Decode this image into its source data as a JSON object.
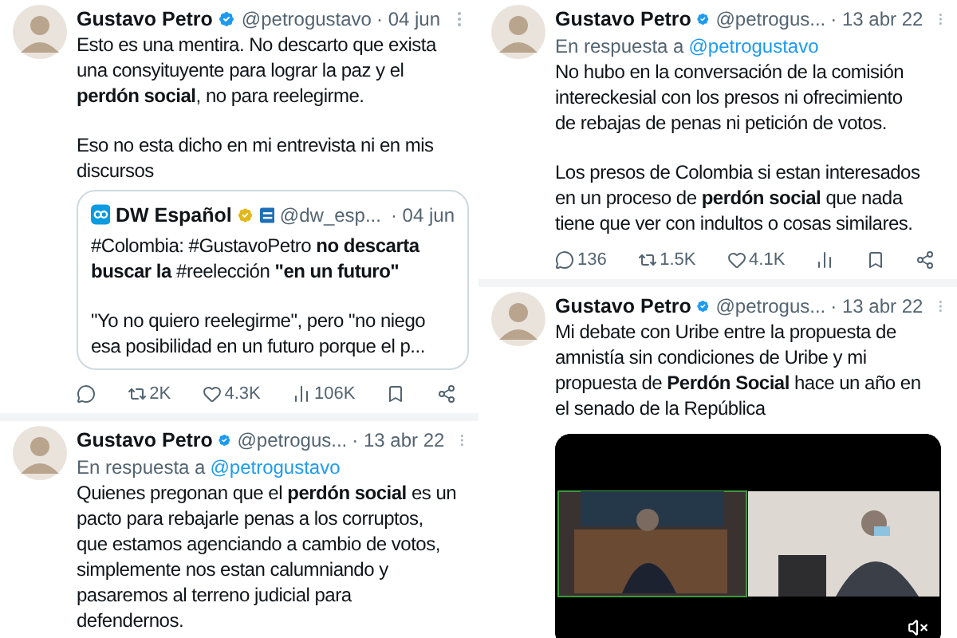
{
  "columns": [
    {
      "tweets": [
        {
          "name": "Gustavo Petro",
          "handle": "@petrogustavo",
          "date": "· 04 jun",
          "paragraphs": [
            "Esto es una mentira. No descarto que exista\nuna consyituyente para lograr la paz y el\n**perdón social**, no para reelegirme.",
            "Eso no esta dicho en mi entrevista ni en mis\ndiscursos"
          ],
          "quote": {
            "name": "DW Español",
            "handle": "@dw_esp...",
            "date": "· 04 jun",
            "paragraphs": [
              "#Colombia: #GustavoPetro **no descarta\nbuscar la** #reelección **\"en un futuro\"**",
              "\"Yo no quiero reelegirme\", pero \"no niego\nesa posibilidad en un futuro porque el p..."
            ]
          },
          "actions": [
            {
              "kind": "reply"
            },
            {
              "kind": "repost",
              "count": "2K"
            },
            {
              "kind": "like",
              "count": "4.3K"
            },
            {
              "kind": "views",
              "count": "106K"
            },
            {
              "kind": "bookmark"
            },
            {
              "kind": "share"
            }
          ]
        },
        {
          "name": "Gustavo Petro",
          "handle": "@petrogus...",
          "date": "· 13 abr 22",
          "reply_to": {
            "prefix": "En respuesta a",
            "handle": "@petrogustavo"
          },
          "paragraphs": [
            "Quienes pregonan que el **perdón social** es un\npacto para rebajarle penas a los corruptos,\nque estamos agenciando a cambio de votos,\nsimplemente nos estan calumniando y\npasaremos al terreno judicial para\ndefendernos."
          ]
        }
      ]
    },
    {
      "tweets": [
        {
          "name": "Gustavo Petro",
          "handle": "@petrogus...",
          "date": "· 13 abr 22",
          "reply_to": {
            "prefix": "En respuesta a",
            "handle": "@petrogustavo"
          },
          "paragraphs": [
            "No hubo en la conversación de la comisión\nintereckesial con los presos ni ofrecimiento\nde rebajas de penas ni petición de votos.",
            "Los presos de Colombia si estan interesados\nen un proceso de **perdón social** que nada\ntiene que ver con indultos o cosas similares."
          ],
          "actions": [
            {
              "kind": "reply",
              "count": "136"
            },
            {
              "kind": "repost",
              "count": "1.5K"
            },
            {
              "kind": "like",
              "count": "4.1K"
            },
            {
              "kind": "views"
            },
            {
              "kind": "bookmark"
            },
            {
              "kind": "share"
            }
          ]
        },
        {
          "name": "Gustavo Petro",
          "handle": "@petrogus...",
          "date": "· 13 abr 22",
          "paragraphs": [
            "Mi debate con Uribe entre la propuesta de\namnistía sin condiciones de Uribe y mi\npropuesta de **Perdón Social** hace un año en\nel senado de la República"
          ],
          "media": {
            "kind": "picture"
          }
        }
      ]
    }
  ]
}
